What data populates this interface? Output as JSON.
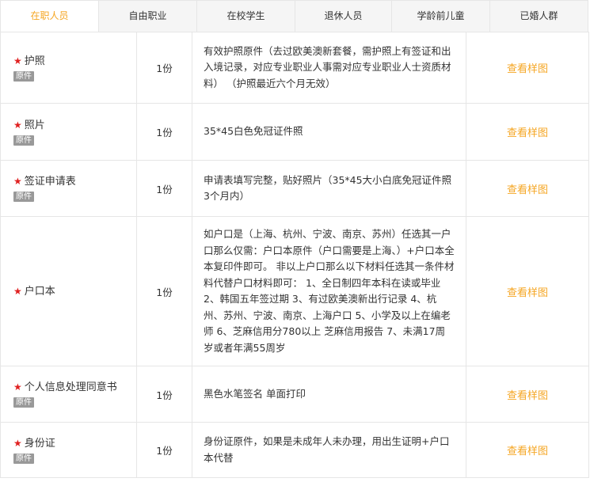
{
  "tabs": [
    {
      "label": "在职人员",
      "active": true
    },
    {
      "label": "自由职业",
      "active": false
    },
    {
      "label": "在校学生",
      "active": false
    },
    {
      "label": "退休人员",
      "active": false
    },
    {
      "label": "学龄前儿童",
      "active": false
    },
    {
      "label": "已婚人群",
      "active": false
    }
  ],
  "colors": {
    "accent": "#f5a623",
    "star": "#e02020",
    "badge": "#999999",
    "border": "#e6e6e6"
  },
  "icons": {
    "required": "star"
  },
  "rows": [
    {
      "name": "护照",
      "badge": "原件",
      "qty": "1份",
      "desc": "有效护照原件（去过欧美澳新套餐，需护照上有签证和出入境记录，对应专业职业人事需对应专业职业人士资质材料） （护照最近六个月无效）",
      "link": "查看样图"
    },
    {
      "name": "照片",
      "badge": "原件",
      "qty": "1份",
      "desc": "35*45白色免冠证件照",
      "link": "查看样图"
    },
    {
      "name": "签证申请表",
      "badge": "原件",
      "qty": "1份",
      "desc": "申请表填写完整，贴好照片（35*45大小白底免冠证件照 3个月内）",
      "link": "查看样图"
    },
    {
      "name": "户口本",
      "badge": "",
      "qty": "1份",
      "desc": "如户口是（上海、杭州、宁波、南京、苏州）任选其一户口那么仅需：户口本原件（户口需要是上海、）+户口本全本复印件即可。 非以上户口那么以下材料任选其一条件材料代替户口材料即可： 1、全日制四年本科在读或毕业 2、韩国五年签过期 3、有过欧美澳新出行记录 4、杭州、苏州、宁波、南京、上海户口 5、小学及以上在编老师 6、芝麻信用分780以上 芝麻信用报告 7、未满17周岁或者年满55周岁",
      "link": "查看样图"
    },
    {
      "name": "个人信息处理同意书",
      "badge": "原件",
      "qty": "1份",
      "desc": "黑色水笔签名 单面打印",
      "link": "查看样图"
    },
    {
      "name": "身份证",
      "badge": "原件",
      "qty": "1份",
      "desc": "身份证原件，如果是未成年人未办理，用出生证明+户口本代替",
      "link": "查看样图"
    }
  ]
}
